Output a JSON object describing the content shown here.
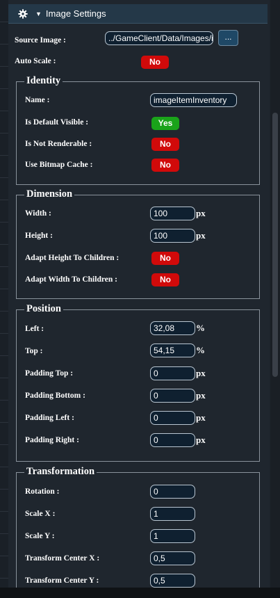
{
  "header": {
    "title": "Image Settings"
  },
  "source_image": {
    "label": "Source Image :",
    "value": "../GameClient/Data/Images/imageItemInventory.png",
    "browse_label": "..."
  },
  "auto_scale": {
    "label": "Auto Scale :",
    "value": "No"
  },
  "identity": {
    "title": "Identity",
    "name": {
      "label": "Name :",
      "value": "imageItemInventory"
    },
    "default_visible": {
      "label": "Is Default Visible :",
      "value": "Yes"
    },
    "not_renderable": {
      "label": "Is Not Renderable :",
      "value": "No"
    },
    "bitmap_cache": {
      "label": "Use Bitmap Cache :",
      "value": "No"
    }
  },
  "dimension": {
    "title": "Dimension",
    "width": {
      "label": "Width :",
      "value": "100",
      "unit": "px"
    },
    "height": {
      "label": "Height :",
      "value": "100",
      "unit": "px"
    },
    "adapt_height": {
      "label": "Adapt Height To Children :",
      "value": "No"
    },
    "adapt_width": {
      "label": "Adapt Width To Children :",
      "value": "No"
    }
  },
  "position": {
    "title": "Position",
    "left": {
      "label": "Left :",
      "value": "32,08",
      "unit": "%"
    },
    "top": {
      "label": "Top :",
      "value": "54,15",
      "unit": "%"
    },
    "padding_top": {
      "label": "Padding Top :",
      "value": "0",
      "unit": "px"
    },
    "padding_bottom": {
      "label": "Padding Bottom :",
      "value": "0",
      "unit": "px"
    },
    "padding_left": {
      "label": "Padding Left :",
      "value": "0",
      "unit": "px"
    },
    "padding_right": {
      "label": "Padding Right :",
      "value": "0",
      "unit": "px"
    }
  },
  "transformation": {
    "title": "Transformation",
    "rotation": {
      "label": "Rotation :",
      "value": "0"
    },
    "scale_x": {
      "label": "Scale X :",
      "value": "1"
    },
    "scale_y": {
      "label": "Scale Y :",
      "value": "1"
    },
    "center_x": {
      "label": "Transform Center X :",
      "value": "0,5"
    },
    "center_y": {
      "label": "Transform Center Y :",
      "value": "0,5"
    }
  },
  "colors": {
    "no": "#d10a0a",
    "yes": "#1aa31a",
    "header": "#243848",
    "panel": "#1f262e"
  },
  "icons": {
    "header_icon": "gear-icon",
    "collapse": "caret-down-icon"
  }
}
